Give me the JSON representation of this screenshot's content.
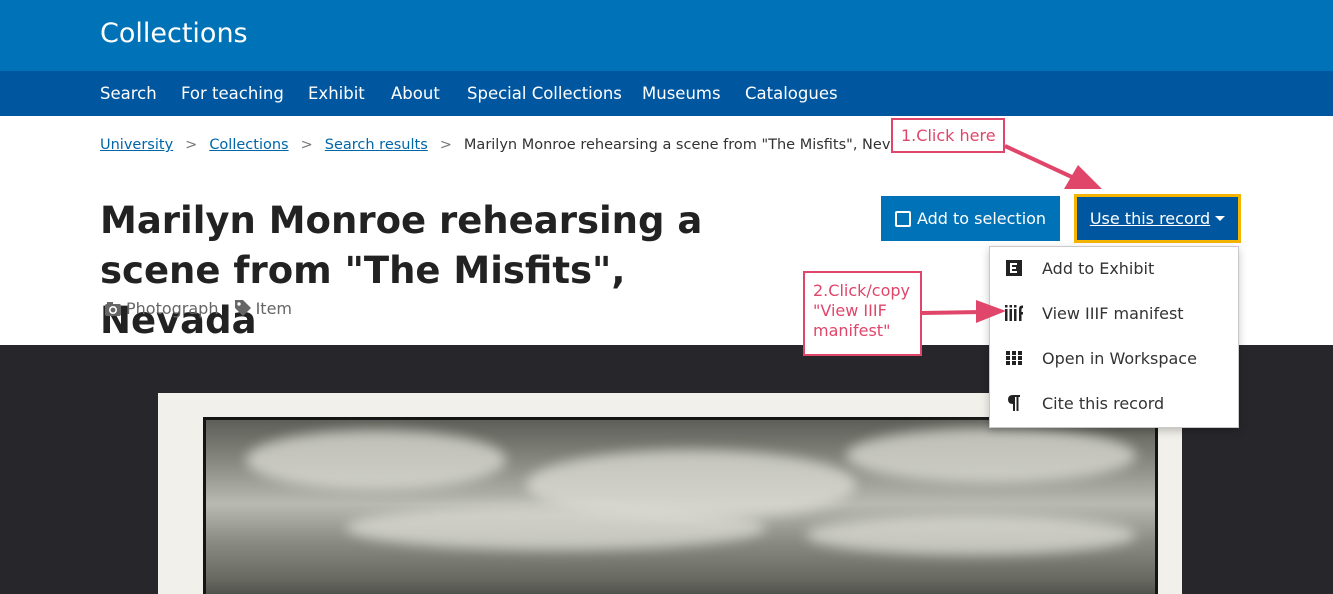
{
  "header": {
    "brand": "Collections",
    "nav": [
      "Search",
      "For teaching",
      "Exhibit",
      "About",
      "Special Collections",
      "Museums",
      "Catalogues"
    ]
  },
  "breadcrumb": {
    "links": [
      "University",
      "Collections",
      "Search results"
    ],
    "current": "Marilyn Monroe rehearsing a scene from \"The Misfits\", Nevada"
  },
  "record": {
    "title_line1": "Marilyn Monroe rehearsing a",
    "title_line2": "scene from \"The Misfits\", Nevada",
    "type": "Photograph",
    "level": "Item"
  },
  "actions": {
    "add_label": "Add to selection",
    "use_label": "Use this record"
  },
  "menu": {
    "items": [
      {
        "label": "Add to Exhibit",
        "icon": "exhibit-icon"
      },
      {
        "label": "View IIIF manifest",
        "icon": "iiif-icon"
      },
      {
        "label": "Open in Workspace",
        "icon": "grid-icon"
      },
      {
        "label": "Cite this record",
        "icon": "pilcrow-icon"
      }
    ]
  },
  "annotations": {
    "step1": "1.Click here",
    "step2_lines": [
      "2.Click/copy",
      "\"View IIIF",
      "manifest\""
    ]
  },
  "colors": {
    "header_blue": "#0073b8",
    "nav_blue": "#0057a0",
    "highlight": "#f5b400",
    "annotation": "#e0456a"
  }
}
